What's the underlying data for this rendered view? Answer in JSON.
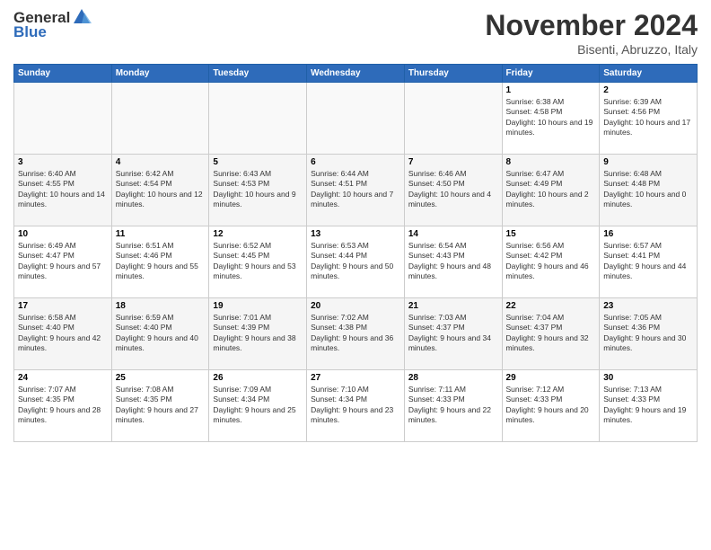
{
  "logo": {
    "text_general": "General",
    "text_blue": "Blue"
  },
  "title": "November 2024",
  "subtitle": "Bisenti, Abruzzo, Italy",
  "days_header": [
    "Sunday",
    "Monday",
    "Tuesday",
    "Wednesday",
    "Thursday",
    "Friday",
    "Saturday"
  ],
  "weeks": [
    [
      {
        "day": "",
        "info": ""
      },
      {
        "day": "",
        "info": ""
      },
      {
        "day": "",
        "info": ""
      },
      {
        "day": "",
        "info": ""
      },
      {
        "day": "",
        "info": ""
      },
      {
        "day": "1",
        "info": "Sunrise: 6:38 AM\nSunset: 4:58 PM\nDaylight: 10 hours and 19 minutes."
      },
      {
        "day": "2",
        "info": "Sunrise: 6:39 AM\nSunset: 4:56 PM\nDaylight: 10 hours and 17 minutes."
      }
    ],
    [
      {
        "day": "3",
        "info": "Sunrise: 6:40 AM\nSunset: 4:55 PM\nDaylight: 10 hours and 14 minutes."
      },
      {
        "day": "4",
        "info": "Sunrise: 6:42 AM\nSunset: 4:54 PM\nDaylight: 10 hours and 12 minutes."
      },
      {
        "day": "5",
        "info": "Sunrise: 6:43 AM\nSunset: 4:53 PM\nDaylight: 10 hours and 9 minutes."
      },
      {
        "day": "6",
        "info": "Sunrise: 6:44 AM\nSunset: 4:51 PM\nDaylight: 10 hours and 7 minutes."
      },
      {
        "day": "7",
        "info": "Sunrise: 6:46 AM\nSunset: 4:50 PM\nDaylight: 10 hours and 4 minutes."
      },
      {
        "day": "8",
        "info": "Sunrise: 6:47 AM\nSunset: 4:49 PM\nDaylight: 10 hours and 2 minutes."
      },
      {
        "day": "9",
        "info": "Sunrise: 6:48 AM\nSunset: 4:48 PM\nDaylight: 10 hours and 0 minutes."
      }
    ],
    [
      {
        "day": "10",
        "info": "Sunrise: 6:49 AM\nSunset: 4:47 PM\nDaylight: 9 hours and 57 minutes."
      },
      {
        "day": "11",
        "info": "Sunrise: 6:51 AM\nSunset: 4:46 PM\nDaylight: 9 hours and 55 minutes."
      },
      {
        "day": "12",
        "info": "Sunrise: 6:52 AM\nSunset: 4:45 PM\nDaylight: 9 hours and 53 minutes."
      },
      {
        "day": "13",
        "info": "Sunrise: 6:53 AM\nSunset: 4:44 PM\nDaylight: 9 hours and 50 minutes."
      },
      {
        "day": "14",
        "info": "Sunrise: 6:54 AM\nSunset: 4:43 PM\nDaylight: 9 hours and 48 minutes."
      },
      {
        "day": "15",
        "info": "Sunrise: 6:56 AM\nSunset: 4:42 PM\nDaylight: 9 hours and 46 minutes."
      },
      {
        "day": "16",
        "info": "Sunrise: 6:57 AM\nSunset: 4:41 PM\nDaylight: 9 hours and 44 minutes."
      }
    ],
    [
      {
        "day": "17",
        "info": "Sunrise: 6:58 AM\nSunset: 4:40 PM\nDaylight: 9 hours and 42 minutes."
      },
      {
        "day": "18",
        "info": "Sunrise: 6:59 AM\nSunset: 4:40 PM\nDaylight: 9 hours and 40 minutes."
      },
      {
        "day": "19",
        "info": "Sunrise: 7:01 AM\nSunset: 4:39 PM\nDaylight: 9 hours and 38 minutes."
      },
      {
        "day": "20",
        "info": "Sunrise: 7:02 AM\nSunset: 4:38 PM\nDaylight: 9 hours and 36 minutes."
      },
      {
        "day": "21",
        "info": "Sunrise: 7:03 AM\nSunset: 4:37 PM\nDaylight: 9 hours and 34 minutes."
      },
      {
        "day": "22",
        "info": "Sunrise: 7:04 AM\nSunset: 4:37 PM\nDaylight: 9 hours and 32 minutes."
      },
      {
        "day": "23",
        "info": "Sunrise: 7:05 AM\nSunset: 4:36 PM\nDaylight: 9 hours and 30 minutes."
      }
    ],
    [
      {
        "day": "24",
        "info": "Sunrise: 7:07 AM\nSunset: 4:35 PM\nDaylight: 9 hours and 28 minutes."
      },
      {
        "day": "25",
        "info": "Sunrise: 7:08 AM\nSunset: 4:35 PM\nDaylight: 9 hours and 27 minutes."
      },
      {
        "day": "26",
        "info": "Sunrise: 7:09 AM\nSunset: 4:34 PM\nDaylight: 9 hours and 25 minutes."
      },
      {
        "day": "27",
        "info": "Sunrise: 7:10 AM\nSunset: 4:34 PM\nDaylight: 9 hours and 23 minutes."
      },
      {
        "day": "28",
        "info": "Sunrise: 7:11 AM\nSunset: 4:33 PM\nDaylight: 9 hours and 22 minutes."
      },
      {
        "day": "29",
        "info": "Sunrise: 7:12 AM\nSunset: 4:33 PM\nDaylight: 9 hours and 20 minutes."
      },
      {
        "day": "30",
        "info": "Sunrise: 7:13 AM\nSunset: 4:33 PM\nDaylight: 9 hours and 19 minutes."
      }
    ]
  ]
}
